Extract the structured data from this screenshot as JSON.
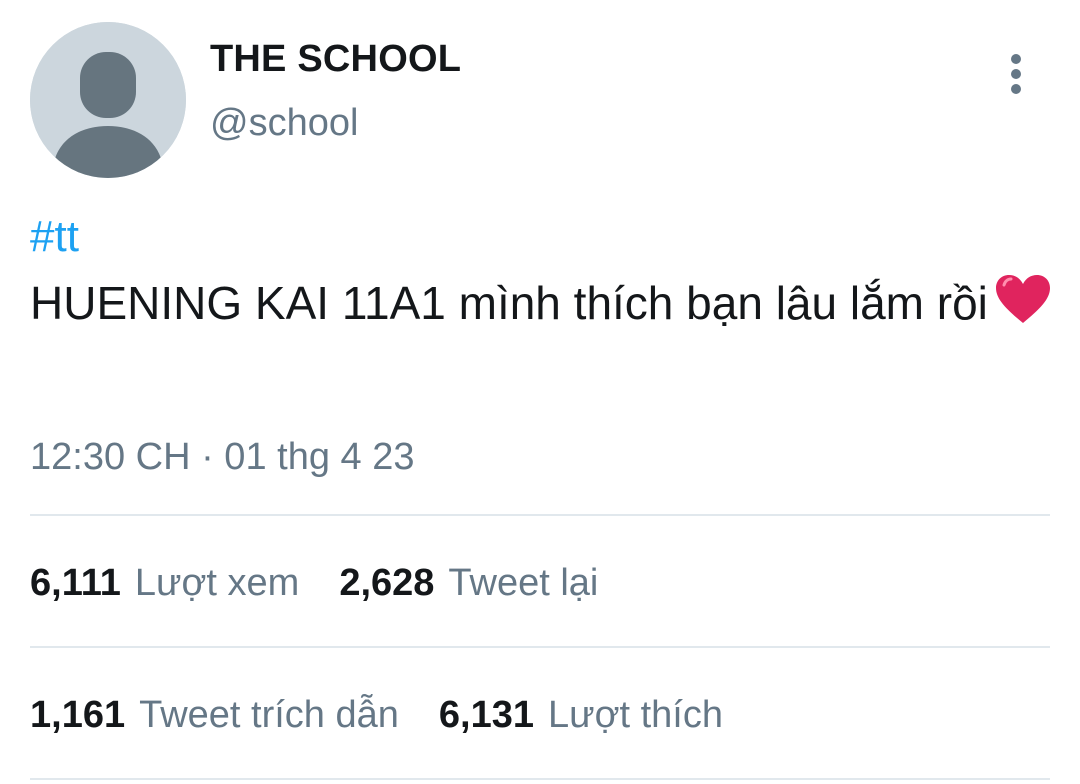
{
  "user": {
    "display_name": "THE SCHOOL",
    "handle": "@school"
  },
  "tweet": {
    "hashtag": "#tt",
    "text": "HUENING KAI 11A1 mình thích bạn lâu lắm rồi",
    "emoji": "heart-icon",
    "timestamp": "12:30 CH · 01 thg 4 23"
  },
  "stats": {
    "views": {
      "count": "6,111",
      "label": "Lượt xem"
    },
    "retweets": {
      "count": "2,628",
      "label": "Tweet lại"
    },
    "quotes": {
      "count": "1,161",
      "label": "Tweet trích dẫn"
    },
    "likes": {
      "count": "6,131",
      "label": "Lượt thích"
    }
  },
  "colors": {
    "link": "#1da1f2",
    "secondary_text": "#657786",
    "primary_text": "#14171a",
    "divider": "#e1e8ed",
    "avatar_bg": "#ccd6dd",
    "avatar_fg": "#66757f",
    "heart": "#e0245e"
  }
}
